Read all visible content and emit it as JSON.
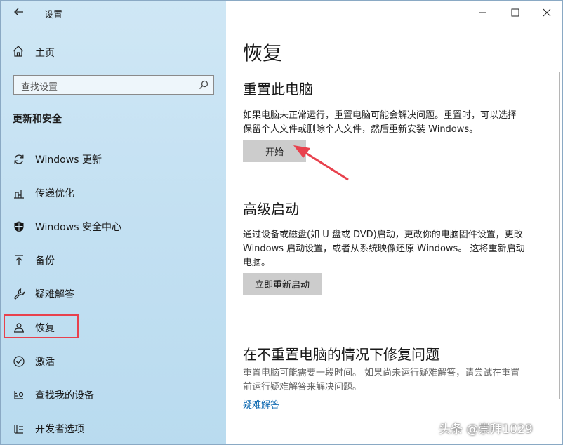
{
  "app": {
    "title": "设置"
  },
  "sidebar": {
    "home_label": "主页",
    "search": {
      "placeholder": "查找设置"
    },
    "section_title": "更新和安全",
    "items": [
      {
        "label": "Windows 更新",
        "icon": "refresh-icon"
      },
      {
        "label": "传递优化",
        "icon": "delivery-optimization-icon"
      },
      {
        "label": "Windows 安全中心",
        "icon": "shield-icon"
      },
      {
        "label": "备份",
        "icon": "backup-arrow-icon"
      },
      {
        "label": "疑难解答",
        "icon": "wrench-icon"
      },
      {
        "label": "恢复",
        "icon": "recovery-icon",
        "selected": true
      },
      {
        "label": "激活",
        "icon": "check-circle-icon"
      },
      {
        "label": "查找我的设备",
        "icon": "find-device-icon"
      },
      {
        "label": "开发者选项",
        "icon": "developer-icon"
      }
    ]
  },
  "main": {
    "title": "恢复",
    "reset": {
      "heading": "重置此电脑",
      "description_line1": "如果电脑未正常运行，重置电脑可能会解决问题。重置时，可以选择",
      "description_line2": "保留个人文件或删除个人文件，然后重新安装 Windows。",
      "button": "开始"
    },
    "advanced": {
      "heading": "高级启动",
      "description_line1": "通过设备或磁盘(如 U 盘或 DVD)启动，更改你的电脑固件设置，更改",
      "description_line2": "Windows 启动设置，或者从系统映像还原 Windows。 这将重新启动",
      "description_line3": "电脑。",
      "button": "立即重新启动"
    },
    "fix": {
      "heading": "在不重置电脑的情况下修复问题",
      "description_line1": "重置电脑可能需要一段时间。 如果尚未运行疑难解答，请尝试在重置",
      "description_line2": "前运行疑难解答来解决问题。",
      "link": "疑难解答"
    }
  },
  "watermark": "头条 @崇拜1029",
  "colors": {
    "accent_link": "#0a67b0",
    "highlight_border": "#e8414d",
    "annotation_arrow": "#e8414d"
  }
}
